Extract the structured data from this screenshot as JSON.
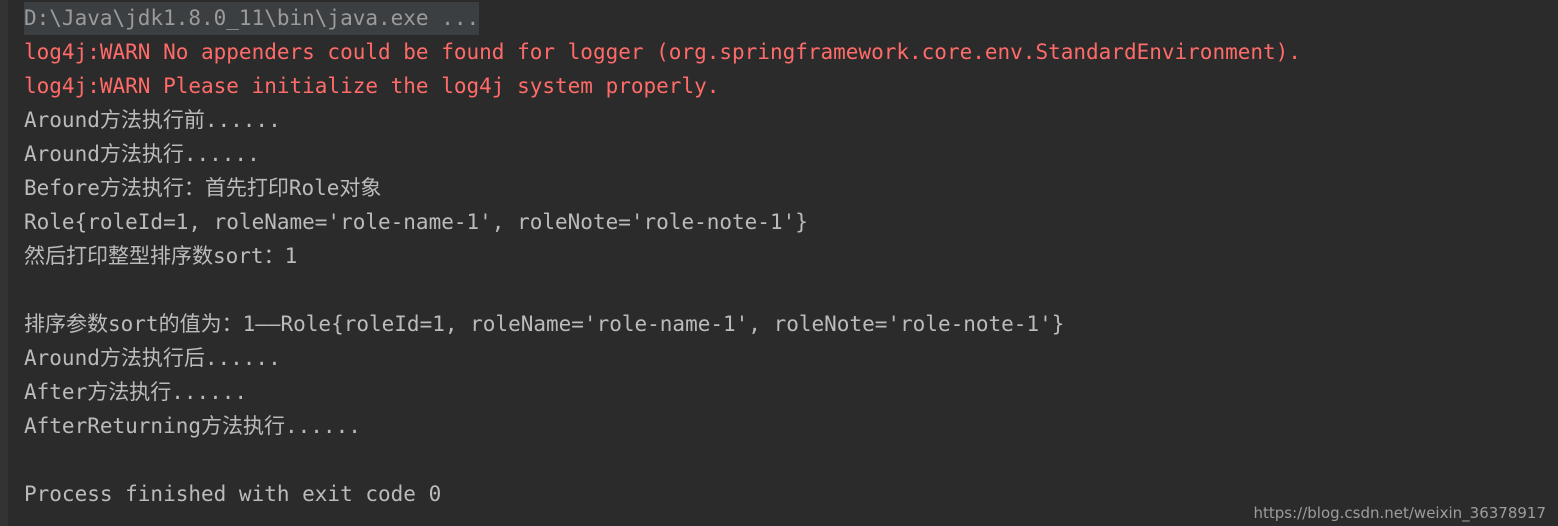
{
  "console": {
    "background_color": "#2b2b2b",
    "gutter_color": "#313335",
    "highlight_color": "#3c3f41",
    "warn_color": "#ff6b68",
    "text_color": "#bbbbbb",
    "command_color": "#9b9b9b",
    "lines": [
      {
        "id": "command-line",
        "kind": "command",
        "text": "D:\\Java\\jdk1.8.0_11\\bin\\java.exe ..."
      },
      {
        "id": "log4j-warn-1",
        "kind": "warn",
        "text": "log4j:WARN No appenders could be found for logger (org.springframework.core.env.StandardEnvironment)."
      },
      {
        "id": "log4j-warn-2",
        "kind": "warn",
        "text": "log4j:WARN Please initialize the log4j system properly."
      },
      {
        "id": "around-before",
        "kind": "output",
        "text": "Around方法执行前......"
      },
      {
        "id": "around-exec",
        "kind": "output",
        "text": "Around方法执行......"
      },
      {
        "id": "before-advice",
        "kind": "output",
        "text": "Before方法执行：首先打印Role对象"
      },
      {
        "id": "role-tostring",
        "kind": "output",
        "text": "Role{roleId=1, roleName='role-name-1', roleNote='role-note-1'}"
      },
      {
        "id": "print-sort",
        "kind": "output",
        "text": "然后打印整型排序数sort：1"
      },
      {
        "id": "blank-1",
        "kind": "blank",
        "text": ""
      },
      {
        "id": "sort-param-value",
        "kind": "output",
        "text": "排序参数sort的值为：1——Role{roleId=1, roleName='role-name-1', roleNote='role-note-1'}"
      },
      {
        "id": "around-after",
        "kind": "output",
        "text": "Around方法执行后......"
      },
      {
        "id": "after-advice",
        "kind": "output",
        "text": "After方法执行......"
      },
      {
        "id": "after-returning-advice",
        "kind": "output",
        "text": "AfterReturning方法执行......"
      },
      {
        "id": "blank-2",
        "kind": "blank",
        "text": ""
      },
      {
        "id": "process-finished",
        "kind": "output",
        "text": "Process finished with exit code 0"
      }
    ]
  },
  "watermark": {
    "text": "https://blog.csdn.net/weixin_36378917"
  }
}
